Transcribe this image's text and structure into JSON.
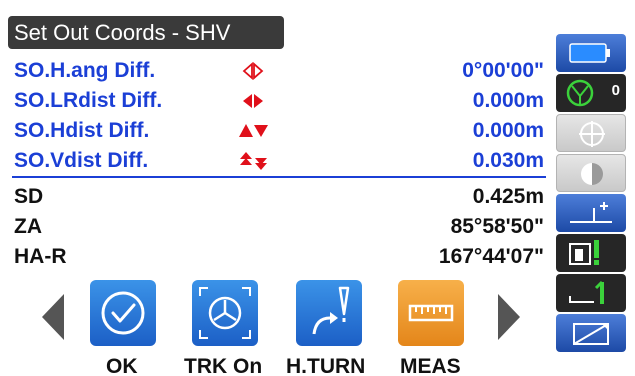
{
  "title": "Set Out Coords - SHV",
  "rows": [
    {
      "label": "SO.H.ang Diff.",
      "value": "0°00'00\"",
      "glyph": "h-angle-diff-icon"
    },
    {
      "label": "SO.LRdist Diff.",
      "value": "0.000m",
      "glyph": "lr-arrows-icon"
    },
    {
      "label": "SO.Hdist Diff.",
      "value": "0.000m",
      "glyph": "up-down-arrows-icon"
    },
    {
      "label": "SO.Vdist Diff.",
      "value": "0.030m",
      "glyph": "double-up-down-arrows-icon"
    },
    {
      "label": "SD",
      "value": "0.425m"
    },
    {
      "label": "ZA",
      "value": "85°58'50\""
    },
    {
      "label": "HA-R",
      "value": "167°44'07\""
    }
  ],
  "softkeys": [
    {
      "label": "OK",
      "icon": "check-circle-icon"
    },
    {
      "label": "TRK On",
      "icon": "tracking-icon"
    },
    {
      "label": "H.TURN",
      "icon": "turn-arrow-icon"
    },
    {
      "label": "MEAS",
      "icon": "ruler-icon"
    }
  ],
  "sidebar": {
    "target_count": "0"
  },
  "colors": {
    "blue_text": "#1b3fd6",
    "title_bg": "#3a3a3a",
    "key_blue": "#1c5fc6",
    "key_orange": "#e4861a"
  }
}
